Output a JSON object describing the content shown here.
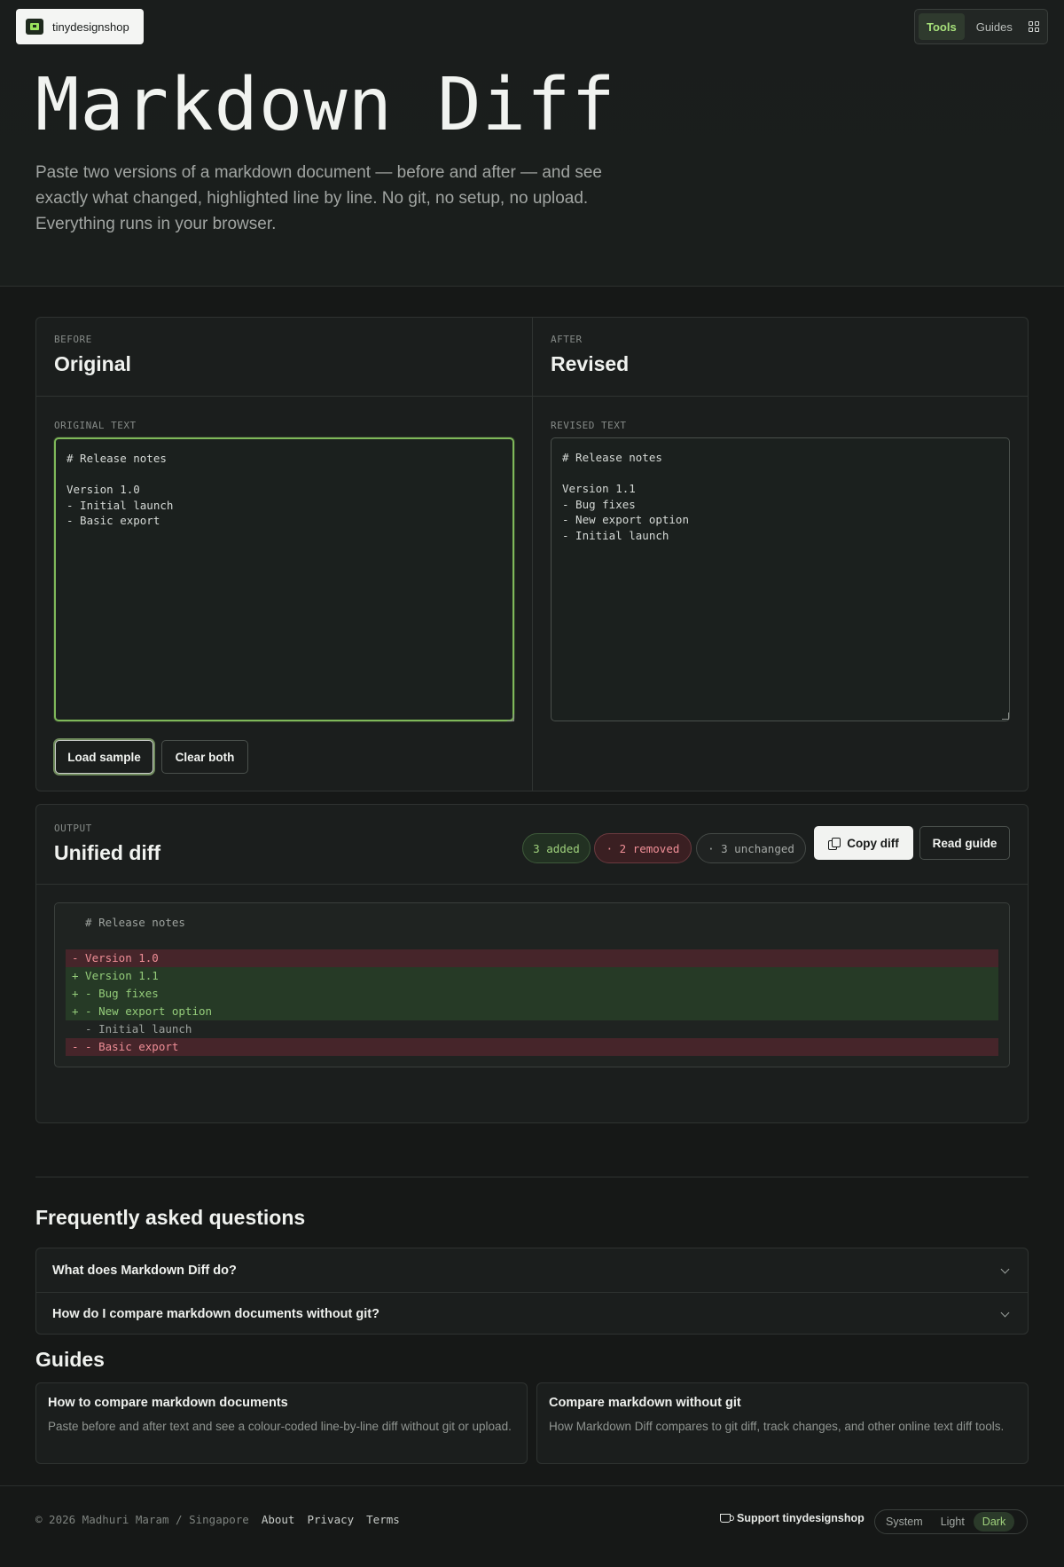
{
  "brand": {
    "name": "tinydesignshop"
  },
  "topnav": {
    "tools": "Tools",
    "guides": "Guides"
  },
  "hero": {
    "title": "Markdown Diff",
    "subtitle": "Paste two versions of a markdown document — before and after — and see exactly what changed, highlighted line by line. No git, no setup, no upload. Everything runs in your browser."
  },
  "before": {
    "eyebrow": "BEFORE",
    "title": "Original",
    "label": "ORIGINAL TEXT",
    "text": "# Release notes\n\nVersion 1.0\n- Initial launch\n- Basic export"
  },
  "after": {
    "eyebrow": "AFTER",
    "title": "Revised",
    "label": "REVISED TEXT",
    "text": "# Release notes\n\nVersion 1.1\n- Bug fixes\n- New export option\n- Initial launch"
  },
  "actions": {
    "load_sample": "Load sample",
    "clear_both": "Clear both"
  },
  "output": {
    "eyebrow": "OUTPUT",
    "title": "Unified diff",
    "added": "3 added",
    "removed": "· 2 removed",
    "unchanged": "· 3 unchanged",
    "copy": "Copy diff",
    "guide": "Read guide",
    "lines": [
      {
        "type": "same",
        "text": "  # Release notes"
      },
      {
        "type": "blank",
        "text": ""
      },
      {
        "type": "del",
        "text": "- Version 1.0"
      },
      {
        "type": "add",
        "text": "+ Version 1.1"
      },
      {
        "type": "add",
        "text": "+ - Bug fixes"
      },
      {
        "type": "add",
        "text": "+ - New export option"
      },
      {
        "type": "same",
        "text": "  - Initial launch"
      },
      {
        "type": "del",
        "text": "- - Basic export"
      }
    ]
  },
  "faq": {
    "title": "Frequently asked questions",
    "items": [
      "What does Markdown Diff do?",
      "How do I compare markdown documents without git?"
    ]
  },
  "guides": {
    "title": "Guides",
    "cards": [
      {
        "title": "How to compare markdown documents",
        "desc": "Paste before and after text and see a colour-coded line-by-line diff without git or upload."
      },
      {
        "title": "Compare markdown without git",
        "desc": "How Markdown Diff compares to git diff, track changes, and other online text diff tools."
      }
    ]
  },
  "footer": {
    "copyright": "© 2026 Madhuri Maram / Singapore",
    "about": "About",
    "privacy": "Privacy",
    "terms": "Terms",
    "support": "Support tinydesignshop",
    "theme": {
      "system": "System",
      "light": "Light",
      "dark": "Dark"
    }
  }
}
